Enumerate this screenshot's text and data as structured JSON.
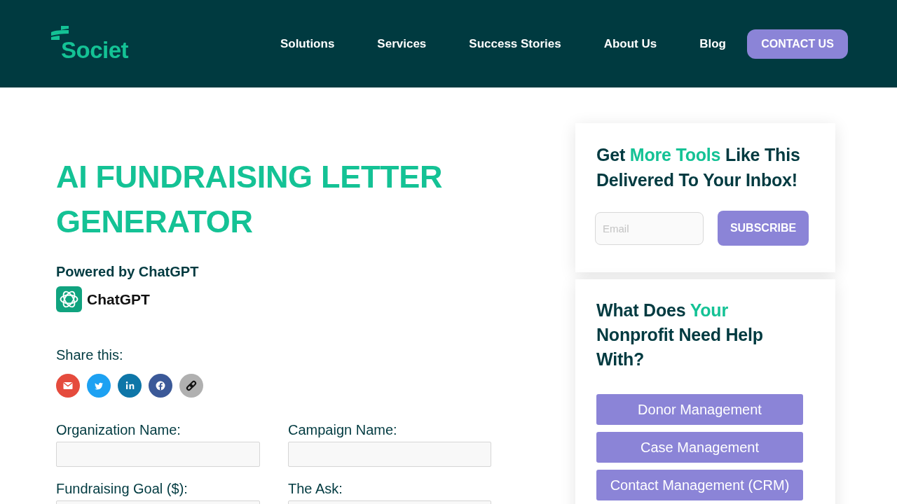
{
  "header": {
    "logo": {
      "text": "Societ"
    },
    "nav": [
      {
        "label": "Solutions"
      },
      {
        "label": "Services"
      },
      {
        "label": "Success Stories"
      },
      {
        "label": "About Us"
      },
      {
        "label": "Blog"
      }
    ],
    "cta": "CONTACT US"
  },
  "main": {
    "title": "AI FUNDRAISING LETTER GENERATOR",
    "powered_by": "Powered by ChatGPT",
    "chatgpt_logo": {
      "text": "ChatGPT"
    },
    "share": {
      "label": "Share this:",
      "buttons": [
        {
          "kind": "email",
          "color": "#e54b3d"
        },
        {
          "kind": "twitter",
          "color": "#1da1f2"
        },
        {
          "kind": "linkedin",
          "color": "#0e76a8"
        },
        {
          "kind": "facebook",
          "color": "#3b5998"
        },
        {
          "kind": "link",
          "color": "#b0b0b0"
        }
      ]
    },
    "form": {
      "fields": [
        {
          "label": "Organization Name:"
        },
        {
          "label": "Campaign Name:"
        },
        {
          "label": "Fundraising Goal ($):"
        },
        {
          "label": "The Ask:"
        }
      ]
    }
  },
  "sidebar": {
    "newsletter": {
      "heading": [
        {
          "text": "Get ",
          "highlight": false
        },
        {
          "text": "More Tools",
          "highlight": true
        },
        {
          "text": " Like This Delivered To Your Inbox!",
          "highlight": false
        }
      ],
      "email": {
        "placeholder": "Email"
      },
      "button": "SUBSCRIBE"
    },
    "help": {
      "heading": [
        {
          "text": "What Does ",
          "highlight": false
        },
        {
          "text": "Your",
          "highlight": true
        },
        {
          "text": " Nonprofit Need Help With?",
          "highlight": false
        }
      ],
      "buttons": [
        {
          "label": "Donor Management"
        },
        {
          "label": "Case Management"
        },
        {
          "label": "Contact Management (CRM)"
        }
      ]
    }
  }
}
